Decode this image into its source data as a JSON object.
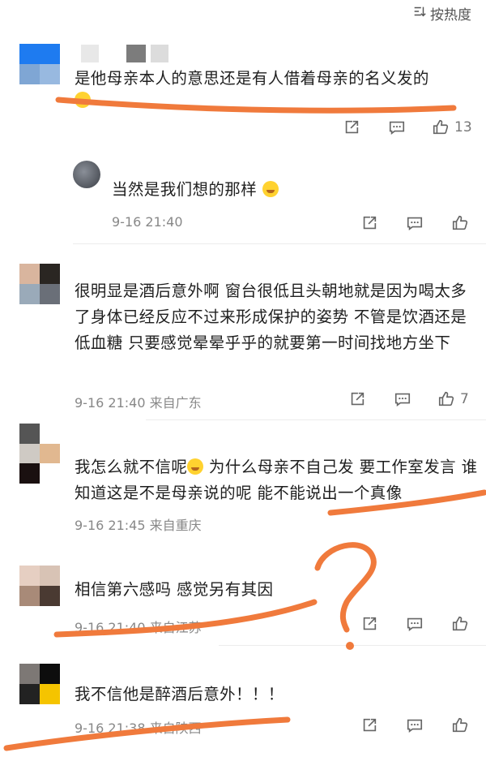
{
  "sort": {
    "label": "按热度"
  },
  "colors": {
    "accent_stroke": "#f07a3c",
    "meta": "#888888"
  },
  "comments": [
    {
      "text": "是他母亲本人的意思还是有人借着母亲的名义发的",
      "like_count": "13"
    },
    {
      "text": "当然是我们想的那样",
      "meta": "9-16 21:40"
    },
    {
      "text": "很明显是酒后意外啊 窗台很低且头朝地就是因为喝太多了身体已经反应不过来形成保护的姿势 不管是饮酒还是低血糖 只要感觉晕晕乎乎的就要第一时间找地方坐下",
      "meta": "9-16 21:40  来自广东",
      "like_count": "7"
    },
    {
      "text_a": "我怎么就不信呢",
      "text_b": " 为什么母亲不自己发 要工作室发言 谁知道这是不是母亲说的呢 能不能说出一个真像",
      "meta": "9-16 21:45  来自重庆"
    },
    {
      "text": "相信第六感吗 感觉另有其因",
      "meta": "9-16 21:40  来自江苏"
    },
    {
      "text": "我不信他是醉酒后意外！！！",
      "meta": "9-16 21:38  来自陕西"
    }
  ]
}
